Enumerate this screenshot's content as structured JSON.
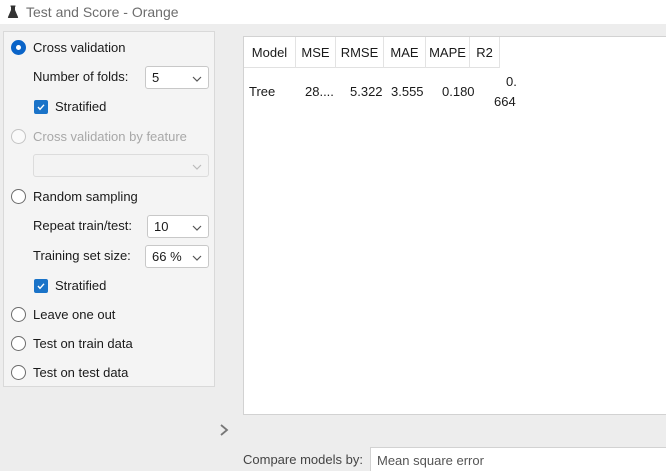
{
  "window": {
    "title": "Test and Score - Orange",
    "icon": "orange-flask-icon"
  },
  "sampling": {
    "cross_validation": {
      "label": "Cross validation",
      "selected": true
    },
    "folds": {
      "label": "Number of folds:",
      "value": "5"
    },
    "cv_stratified": {
      "label": "Stratified",
      "checked": true
    },
    "cv_by_feature": {
      "label": "Cross validation by feature",
      "enabled": false,
      "value": ""
    },
    "random_sampling": {
      "label": "Random sampling",
      "selected": false
    },
    "repeat": {
      "label": "Repeat train/test:",
      "value": "10"
    },
    "train_size": {
      "label": "Training set size:",
      "value": "66 %"
    },
    "rs_stratified": {
      "label": "Stratified",
      "checked": true
    },
    "leave_one_out": {
      "label": "Leave one out",
      "selected": false
    },
    "test_on_train": {
      "label": "Test on train data",
      "selected": false
    },
    "test_on_test": {
      "label": "Test on test data",
      "selected": false
    }
  },
  "results": {
    "columns": [
      "Model",
      "MSE",
      "RMSE",
      "MAE",
      "MAPE",
      "R2"
    ],
    "rows": [
      {
        "model": "Tree",
        "mse": "28....",
        "rmse": "5.322",
        "mae": "3.555",
        "mape": "0.180",
        "r2_line1": "0.",
        "r2_line2": "664"
      }
    ]
  },
  "compare": {
    "label": "Compare models by:",
    "value": "Mean square error"
  },
  "colors": {
    "accent": "#0a64c8",
    "checkbox": "#1a73c8",
    "panel_bg": "#f4f4f4",
    "window_bg": "#ededed"
  }
}
